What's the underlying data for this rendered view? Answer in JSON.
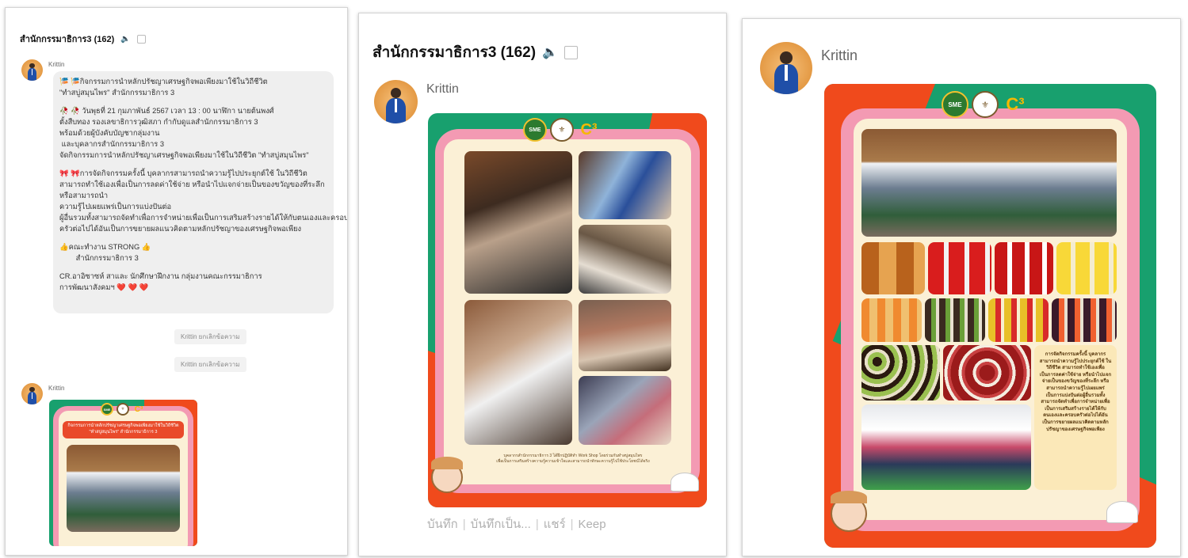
{
  "group_title": "สำนักกรรมาธิการ3 (162)",
  "sender": "Krittin",
  "panel1": {
    "message_paragraphs": [
      "🎏 🎏กิจกรรมการนำหลักปรัชญาเศรษฐกิจพอเพียงมาใช้ในวิถีชีวิต\n\"ทำสบู่สมุนไพร\" สำนักกรรมาธิการ 3",
      "🥀 🥀 วันพุธที่ 21 กุมภาพันธ์ 2567 เวลา 13 : 00 นาฬิกา นายต้นพงศ์\nตั้งสืบทอง รองเลขาธิการวุฒิสภา กำกับดูแลสำนักกรรมาธิการ 3\nพร้อมด้วยผู้บังคับบัญชากลุ่มงาน\n และบุคลากรสำนักกรรมาธิการ 3\nจัดกิจกรรมการนำหลักปรัชญาเศรษฐกิจพอเพียงมาใช้ในวิถีชีวิต \"ทำสบู่สมุนไพร\"",
      "🎀 🎀การจัดกิจกรรมครั้งนี้ บุคลากรสามารถนำความรู้ไปประยุกต์ใช้ ในวิถีชีวิต\nสามารถทำใช้เองเพื่อเป็นการลดค่าใช้จ่าย หรือนำไปแจกจ่ายเป็นของขวัญของที่ระลึก\nหรือสามารถนำ\nความรู้ไปเผยแพร่เป็นการแบ่งปันต่อ\nผู้อื่นรวมทั้งสามารถจัดทำเพื่อการจำหน่ายเพื่อเป็นการเสริมสร้างรายได้ให้กับตนเองและครอบ\nครัวต่อไปได้อันเป็นการขยายผลแนวคิดตามหลักปรัชญาของเศรษฐกิจพอเพียง",
      "👍คณะทำงาน STRONG 👍\n        สำนักกรรมาธิการ 3",
      "CR.อาอิซาซห์ สาและ นักศึกษาฝึกงาน กลุ่มงานคณะกรรมาธิการ\nการพัฒนาสังคมฯ ❤️ ❤️ ❤️"
    ],
    "unsent_notices": [
      "Krittin ยกเลิกข้อความ",
      "Krittin ยกเลิกข้อความ"
    ],
    "poster_banner": "กิจกรรมการนำหลักปรัชญาเศรษฐกิจพอเพียงมาใช้ในวิถีชีวิต\n\"ทำสบู่สมุนไพร\" สำนักกรรมาธิการ 3"
  },
  "panel2": {
    "poster_caption": "บุคลากรสำนักกรรมาธิการ 3 ได้ฝึกปฏิบัติทำ Work Shop โดยร่วมกันทำสบู่สมุนไพร\nเพื่อเป็นการเสริมสร้างความรู้ความเข้าใจและสามารถนำทักษะความรู้ไปใช้ประโยชน์ได้จริง",
    "actions": [
      "บันทึก",
      "บันทึกเป็น...",
      "แชร์",
      "Keep"
    ]
  },
  "panel3": {
    "textbox": "การจัดกิจกรรมครั้งนี้ บุคลากรสามารถนำความรู้ไปประยุกต์ใช้ ในวิถีชีวิต สามารถทำใช้เองเพื่อเป็นการลดค่าใช้จ่าย หรือนำไปแจกจ่ายเป็นของขวัญของที่ระลึก หรือสามารถนำความรู้ไปเผยแพร่เป็นการแบ่งปันต่อผู้อื่นรวมทั้งสามารถจัดทำเพื่อการจำหน่ายเพื่อเป็นการเสริมสร้างรายได้ให้กับตนเองและครอบครัวต่อไปได้อันเป็นการขยายผลแนวคิดตามหลักปรัชญาของเศรษฐกิจพอเพียง"
  },
  "logo_text": {
    "sme": "SME",
    "c3": "C³"
  },
  "colors": {
    "green": "#18a06e",
    "orange": "#f04a1c",
    "pink": "#f39ab3",
    "cream": "#fbf0d6"
  }
}
